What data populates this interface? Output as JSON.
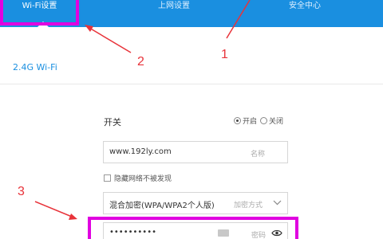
{
  "nav": {
    "tabs": [
      {
        "label": "Wi-Fi设置",
        "active": true
      },
      {
        "label": "上网设置",
        "active": false
      },
      {
        "label": "安全中心",
        "active": false
      }
    ]
  },
  "annotations": {
    "one": "1",
    "two": "2",
    "three": "3",
    "color": "#e8333a",
    "highlight_color": "#e000e0"
  },
  "section": {
    "title": "2.4G Wi-Fi"
  },
  "form": {
    "switch_label": "开关",
    "radio_on": "开启",
    "radio_off": "关闭",
    "radio_selected": "开启",
    "ssid_value": "www.192ly.com",
    "ssid_hint": "名称",
    "hide_label": "隐藏网络不被发现",
    "hide_checked": false,
    "encryption_value": "混合加密(WPA/WPA2个人版)",
    "encryption_hint": "加密方式",
    "password_value": "••••••••••",
    "password_hint": "密码"
  },
  "colors": {
    "nav_bg": "#1a8fe0",
    "accent": "#1a8fe0"
  },
  "icons": [
    "chevron-down-icon",
    "keyboard-icon",
    "eye-icon"
  ]
}
